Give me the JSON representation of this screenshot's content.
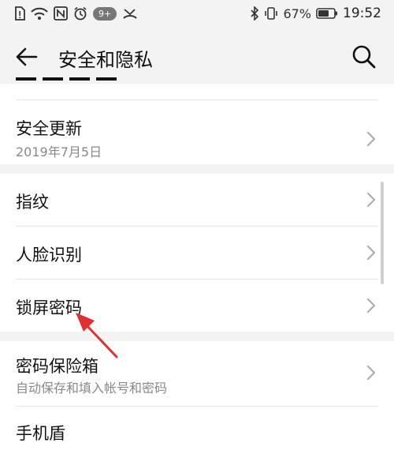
{
  "status_bar": {
    "notification_count": "9+",
    "battery_percent": "67%",
    "time": "19:52"
  },
  "header": {
    "title": "安全和隐私"
  },
  "rows": {
    "security_update": {
      "title": "安全更新",
      "subtitle": "2019年7月5日"
    },
    "fingerprint": {
      "title": "指纹"
    },
    "face_recognition": {
      "title": "人脸识别"
    },
    "lock_screen_password": {
      "title": "锁屏密码"
    },
    "password_vault": {
      "title": "密码保险箱",
      "subtitle": "自动保存和填入帐号和密码"
    },
    "phone_shield": {
      "title": "手机盾"
    }
  },
  "colors": {
    "background": "#f3f3f3",
    "card": "#ffffff",
    "annotation_arrow": "#e23030"
  }
}
